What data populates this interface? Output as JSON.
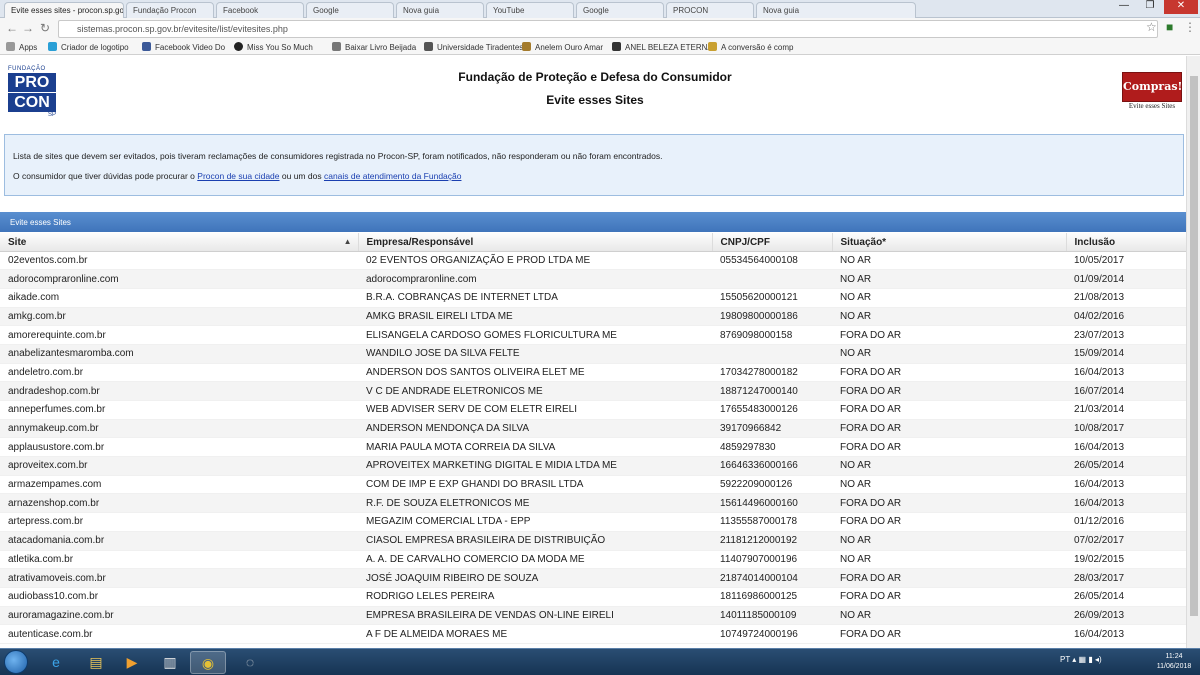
{
  "browser": {
    "tabs": [
      {
        "label": "Evite esses sites - procon.sp.gov.br",
        "active": true
      },
      {
        "label": "Fundação Procon",
        "active": false
      },
      {
        "label": "Facebook",
        "active": false
      },
      {
        "label": "Google",
        "active": false
      },
      {
        "label": "Nova guia",
        "active": false
      },
      {
        "label": "YouTube",
        "active": false
      },
      {
        "label": "Google",
        "active": false
      },
      {
        "label": "PROCON",
        "active": false
      },
      {
        "label": "Nova guia",
        "active": false
      }
    ],
    "url": "sistemas.procon.sp.gov.br/evitesite/list/evitesites.php",
    "bookmarks": [
      "Apps",
      "Criador de logotipo",
      "Facebook Video Do",
      "Miss You So Much",
      "Baixar Livro Beijada",
      "Universidade Tiradentes",
      "Anelem Ouro Amar",
      "ANEL BELEZA ETERNA",
      "A conversão é comp"
    ]
  },
  "header": {
    "title": "Fundação de Proteção e Defesa do Consumidor",
    "subtitle": "Evite esses Sites",
    "logo": {
      "small": "FUNDAÇÃO",
      "line1": "PRO",
      "line2": "CON",
      "line3": "SP"
    },
    "compras_badge": "Compras!",
    "compras_caption": "Evite esses Sites"
  },
  "info": {
    "line1": "Lista de sites que devem ser evitados, pois tiveram reclamações de consumidores registrada no Procon-SP, foram notificados, não responderam ou não foram encontrados.",
    "line2_prefix": "O consumidor que tiver dúvidas pode procurar o",
    "link1": "Procon de sua cidade",
    "line2_mid": "ou um dos",
    "link2": "canais de atendimento da Fundação"
  },
  "panel": {
    "title": "Evite esses Sites"
  },
  "table": {
    "columns": [
      "Site",
      "Empresa/Responsável",
      "CNPJ/CPF",
      "Situação*",
      "Inclusão"
    ],
    "rows": [
      [
        "02eventos.com.br",
        "02 EVENTOS ORGANIZAÇÃO E PROD LTDA ME",
        "05534564000108",
        "NO AR",
        "10/05/2017"
      ],
      [
        "adorocompraronline.com",
        "adorocompraronline.com",
        "",
        "NO AR",
        "01/09/2014"
      ],
      [
        "aikade.com",
        "B.R.A. COBRANÇAS DE INTERNET LTDA",
        "15505620000121",
        "NO AR",
        "21/08/2013"
      ],
      [
        "amkg.com.br",
        "AMKG BRASIL EIRELI LTDA ME",
        "19809800000186",
        "NO AR",
        "04/02/2016"
      ],
      [
        "amorerequinte.com.br",
        "ELISANGELA CARDOSO GOMES FLORICULTURA ME",
        "8769098000158",
        "FORA DO AR",
        "23/07/2013"
      ],
      [
        "anabelizantesmaromba.com",
        "WANDILO JOSE DA SILVA FELTE",
        "",
        "NO AR",
        "15/09/2014"
      ],
      [
        "andeletro.com.br",
        "ANDERSON DOS SANTOS OLIVEIRA ELET ME",
        "17034278000182",
        "FORA DO AR",
        "16/04/2013"
      ],
      [
        "andradeshop.com.br",
        "V C DE ANDRADE ELETRONICOS ME",
        "18871247000140",
        "FORA DO AR",
        "16/07/2014"
      ],
      [
        "anneperfumes.com.br",
        "WEB ADVISER SERV DE COM ELETR EIRELI",
        "17655483000126",
        "FORA DO AR",
        "21/03/2014"
      ],
      [
        "annymakeup.com.br",
        "ANDERSON MENDONÇA DA SILVA",
        "39170966842",
        "FORA DO AR",
        "10/08/2017"
      ],
      [
        "applausustore.com.br",
        "MARIA PAULA MOTA CORREIA DA SILVA",
        "4859297830",
        "FORA DO AR",
        "16/04/2013"
      ],
      [
        "aproveitex.com.br",
        "APROVEITEX MARKETING DIGITAL E MIDIA LTDA ME",
        "16646336000166",
        "NO AR",
        "26/05/2014"
      ],
      [
        "armazempames.com",
        "COM DE IMP E EXP GHANDI DO BRASIL LTDA",
        "5922209000126",
        "NO AR",
        "16/04/2013"
      ],
      [
        "arnazenshop.com.br",
        "R.F. DE SOUZA ELETRONICOS ME",
        "15614496000160",
        "FORA DO AR",
        "16/04/2013"
      ],
      [
        "artepress.com.br",
        "MEGAZIM COMERCIAL LTDA - EPP",
        "11355587000178",
        "FORA DO AR",
        "01/12/2016"
      ],
      [
        "atacadomania.com.br",
        "CIASOL EMPRESA BRASILEIRA DE DISTRIBUIÇÃO",
        "21181212000192",
        "NO AR",
        "07/02/2017"
      ],
      [
        "atletika.com.br",
        "A. A. DE CARVALHO COMERCIO DA MODA   ME",
        "11407907000196",
        "NO AR",
        "19/02/2015"
      ],
      [
        "atrativamoveis.com.br",
        "JOSÉ JOAQUIM RIBEIRO DE SOUZA",
        "21874014000104",
        "FORA DO AR",
        "28/03/2017"
      ],
      [
        "audiobass10.com.br",
        "RODRIGO LELES PEREIRA",
        "18116986000125",
        "FORA DO AR",
        "26/05/2014"
      ],
      [
        "auroramagazine.com.br",
        "EMPRESA BRASILEIRA DE VENDAS ON-LINE EIRELI",
        "14011185000109",
        "NO AR",
        "26/09/2013"
      ],
      [
        "autenticase.com.br",
        "A F DE ALMEIDA MORAES ME",
        "10749724000196",
        "FORA DO AR",
        "16/04/2013"
      ]
    ]
  },
  "taskbar": {
    "time": "11:24",
    "date": "11/06/2018",
    "tray": "PT"
  },
  "colors": {
    "panel_header": "#4a80c4",
    "info_bg": "#e8f1fb",
    "link": "#1a3fb0"
  }
}
